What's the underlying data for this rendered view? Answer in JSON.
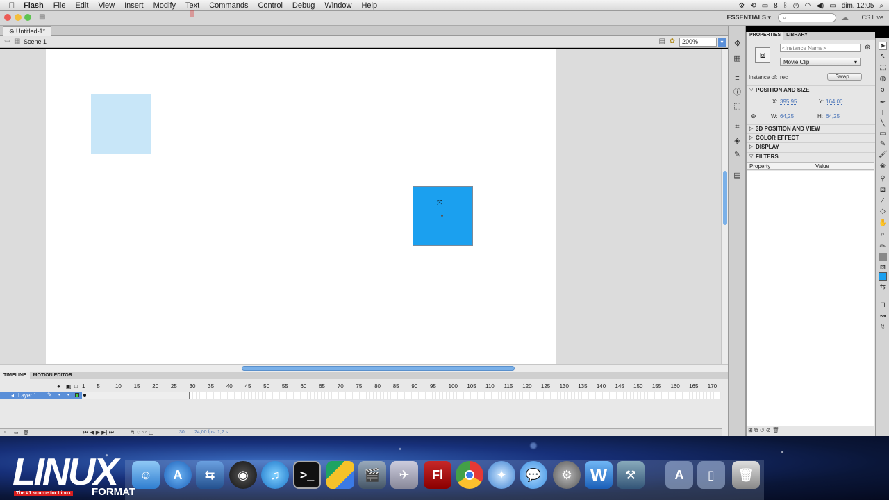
{
  "menubar": {
    "app": "Flash",
    "menus": [
      "File",
      "Edit",
      "View",
      "Insert",
      "Modify",
      "Text",
      "Commands",
      "Control",
      "Debug",
      "Window",
      "Help"
    ],
    "status_number": "8",
    "clock": "dim. 12:05"
  },
  "approw": {
    "workspace": "ESSENTIALS ▾",
    "cslive": "CS Live"
  },
  "document": {
    "tab": "Untitled-1*",
    "scene": "Scene 1",
    "zoom": "200%"
  },
  "stage": {
    "shapes": [
      {
        "name": "faded-rectangle",
        "color": "#c8e6f8"
      },
      {
        "name": "selected-movie-clip",
        "color": "#1ba0ef"
      }
    ]
  },
  "timeline": {
    "tabs": [
      "TIMELINE",
      "MOTION EDITOR"
    ],
    "layer": "Layer 1",
    "frame_numbers": [
      "1",
      "5",
      "10",
      "15",
      "20",
      "25",
      "30",
      "35",
      "40",
      "45",
      "50",
      "55",
      "60",
      "65",
      "70",
      "75",
      "80",
      "85",
      "90",
      "95",
      "100",
      "105",
      "110",
      "115",
      "120",
      "125",
      "130",
      "135",
      "140",
      "145",
      "150",
      "155",
      "160",
      "165",
      "170"
    ],
    "current_frame": "30",
    "fps": "24,00 fps",
    "time": "1,2 s"
  },
  "properties": {
    "tabs": [
      "PROPERTIES",
      "LIBRARY"
    ],
    "instance_placeholder": "<Instance Name>",
    "type": "Movie Clip",
    "instance_of_label": "Instance of:",
    "instance_of": "rec",
    "swap": "Swap...",
    "sections": {
      "position_size": "POSITION AND SIZE",
      "position_3d": "3D POSITION AND VIEW",
      "color_effect": "COLOR EFFECT",
      "display": "DISPLAY",
      "filters": "FILTERS"
    },
    "x_label": "X:",
    "x": "395,95",
    "y_label": "Y:",
    "y": "164,00",
    "w_label": "W:",
    "w": "64,25",
    "h_label": "H:",
    "h": "64,25",
    "filter_cols": [
      "Property",
      "Value"
    ]
  },
  "dock": {
    "logo_big": "LINUX",
    "logo_tagline": "The #1 source for Linux",
    "logo_format": "FORMAT",
    "flash_label": "Fl"
  },
  "colors": {
    "accent": "#5a8fd8",
    "selected_shape": "#1ba0ef",
    "faded_shape": "#c8e6f8",
    "playhead": "#dd1111"
  }
}
